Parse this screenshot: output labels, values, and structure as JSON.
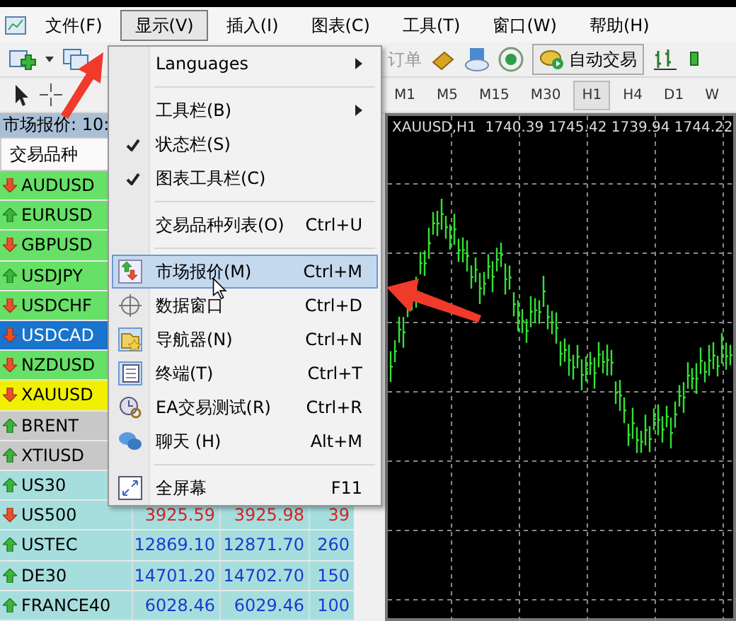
{
  "menubar": [
    {
      "label": "文件(F)",
      "selected": false
    },
    {
      "label": "显示(V)",
      "selected": true
    },
    {
      "label": "插入(I)",
      "selected": false
    },
    {
      "label": "图表(C)",
      "selected": false
    },
    {
      "label": "工具(T)",
      "selected": false
    },
    {
      "label": "窗口(W)",
      "selected": false
    },
    {
      "label": "帮助(H)",
      "selected": false
    }
  ],
  "toolbar": {
    "order_label": "订单",
    "autotrade_label": "自动交易"
  },
  "timeframes": [
    {
      "label": "M1",
      "selected": false
    },
    {
      "label": "M5",
      "selected": false
    },
    {
      "label": "M15",
      "selected": false
    },
    {
      "label": "M30",
      "selected": false
    },
    {
      "label": "H1",
      "selected": true
    },
    {
      "label": "H4",
      "selected": false
    },
    {
      "label": "D1",
      "selected": false
    },
    {
      "label": "W",
      "selected": false
    }
  ],
  "market_watch": {
    "title": "市场报价: 10:",
    "column_1": "交易品种",
    "rows": [
      {
        "symbol": "AUDUSD",
        "rising": false,
        "color": "#66e066",
        "selected": false
      },
      {
        "symbol": "EURUSD",
        "rising": true,
        "color": "#66e066",
        "selected": false
      },
      {
        "symbol": "GBPUSD",
        "rising": false,
        "color": "#66e066",
        "selected": false
      },
      {
        "symbol": "USDJPY",
        "rising": true,
        "color": "#66e066",
        "selected": false
      },
      {
        "symbol": "USDCHF",
        "rising": false,
        "color": "#66e066",
        "selected": false
      },
      {
        "symbol": "USDCAD",
        "rising": false,
        "color": "#1874cd",
        "selected": true
      },
      {
        "symbol": "NZDUSD",
        "rising": false,
        "color": "#66e066",
        "selected": false
      },
      {
        "symbol": "XAUUSD",
        "rising": false,
        "color": "#f0f000",
        "selected": false
      },
      {
        "symbol": "BRENT",
        "rising": true,
        "color": "#c8c8c8",
        "selected": false
      },
      {
        "symbol": "XTIUSD",
        "rising": true,
        "color": "#c8c8c8",
        "selected": false
      },
      {
        "symbol": "US30",
        "rising": true,
        "color": "#a6dede",
        "selected": false
      },
      {
        "symbol": "US500",
        "rising": false,
        "color": "#a6dede",
        "selected": false,
        "bid": "3925.59",
        "ask": "3925.98",
        "spread": "39"
      },
      {
        "symbol": "USTEC",
        "rising": true,
        "color": "#a6dede",
        "selected": false,
        "bid": "12869.10",
        "ask": "12871.70",
        "spread": "260"
      },
      {
        "symbol": "DE30",
        "rising": true,
        "color": "#a6dede",
        "selected": false,
        "bid": "14701.20",
        "ask": "14702.70",
        "spread": "150"
      },
      {
        "symbol": "FRANCE40",
        "rising": true,
        "color": "#a6dede",
        "selected": false,
        "bid": "6028.46",
        "ask": "6029.46",
        "spread": "100"
      }
    ]
  },
  "chart": {
    "header": "XAUUSD,H1  1740.39 1745.42 1739.94 1744.22"
  },
  "view_menu": [
    {
      "kind": "submenu",
      "label": "Languages",
      "selected": false
    },
    {
      "kind": "separator"
    },
    {
      "kind": "submenu",
      "label": "工具栏(B)",
      "selected": false
    },
    {
      "kind": "check",
      "label": "状态栏(S)",
      "checked": true,
      "selected": false
    },
    {
      "kind": "check",
      "label": "图表工具栏(C)",
      "checked": true,
      "selected": false
    },
    {
      "kind": "separator"
    },
    {
      "kind": "command",
      "label": "交易品种列表(O)",
      "shortcut": "Ctrl+U",
      "selected": false
    },
    {
      "kind": "separator"
    },
    {
      "kind": "command",
      "label": "市场报价(M)",
      "shortcut": "Ctrl+M",
      "selected": true
    },
    {
      "kind": "command",
      "label": "数据窗口",
      "shortcut": "Ctrl+D",
      "selected": false
    },
    {
      "kind": "command",
      "label": "导航器(N)",
      "shortcut": "Ctrl+N",
      "selected": false
    },
    {
      "kind": "command",
      "label": "终端(T)",
      "shortcut": "Ctrl+T",
      "selected": false
    },
    {
      "kind": "command",
      "label": "EA交易测试(R)",
      "shortcut": "Ctrl+R",
      "selected": false
    },
    {
      "kind": "command",
      "label": "聊天 (H)",
      "shortcut": "Alt+M",
      "selected": false
    },
    {
      "kind": "separator"
    },
    {
      "kind": "command",
      "label": "全屏幕",
      "shortcut": "F11",
      "selected": false
    }
  ]
}
